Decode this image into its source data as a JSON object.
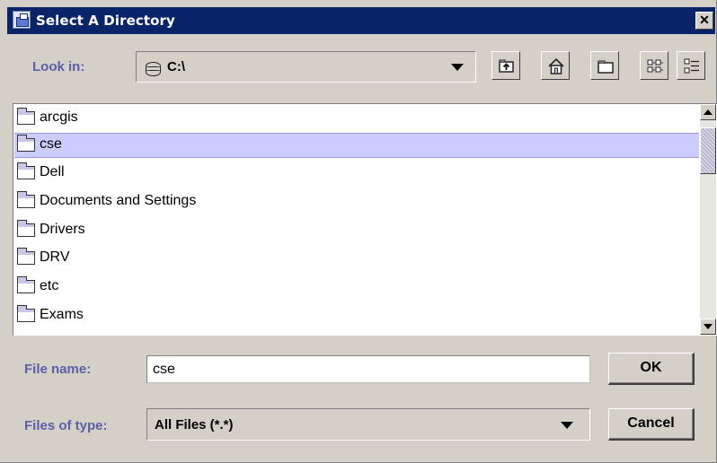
{
  "window": {
    "title": "Select A Directory",
    "close_glyph": "✕"
  },
  "look_in": {
    "label": "Look in:",
    "value": "C:\\",
    "icon": "drive-icon"
  },
  "toolbar": {
    "buttons": [
      {
        "name": "up-one-level",
        "icon": "folder-up-icon"
      },
      {
        "name": "home",
        "icon": "home-icon"
      },
      {
        "name": "new-folder",
        "icon": "new-folder-icon"
      },
      {
        "name": "list-view",
        "icon": "list-view-icon"
      },
      {
        "name": "details-view",
        "icon": "details-view-icon"
      }
    ]
  },
  "files": {
    "items": [
      {
        "name": "arcgis",
        "selected": false
      },
      {
        "name": "cse",
        "selected": true
      },
      {
        "name": "Dell",
        "selected": false
      },
      {
        "name": "Documents and Settings",
        "selected": false
      },
      {
        "name": "Drivers",
        "selected": false
      },
      {
        "name": "DRV",
        "selected": false
      },
      {
        "name": "etc",
        "selected": false
      },
      {
        "name": "Exams",
        "selected": false
      }
    ]
  },
  "file_name": {
    "label": "File name:",
    "value": "cse"
  },
  "file_type": {
    "label": "Files of type:",
    "value": "All Files (*.*)"
  },
  "buttons": {
    "ok": "OK",
    "cancel": "Cancel"
  },
  "colors": {
    "title_bar": "#0a246a",
    "label_text": "#5b5fa8",
    "selection": "#ccccff",
    "dialog_bg": "#d4d0c8"
  }
}
